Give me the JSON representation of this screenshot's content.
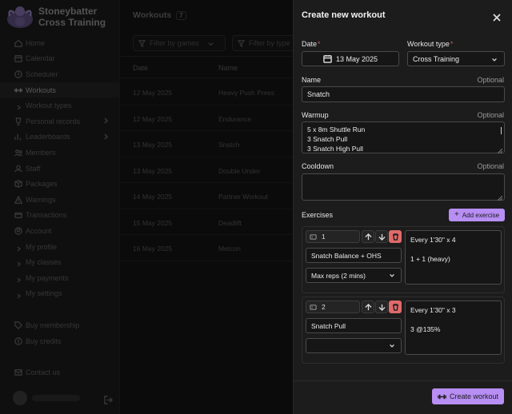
{
  "brand": {
    "line1": "Stoneybatter",
    "line2": "Cross Training"
  },
  "sidebar": {
    "items": [
      {
        "label": "Home",
        "icon": "home-icon"
      },
      {
        "label": "Calendar",
        "icon": "calendar-icon"
      },
      {
        "label": "Scheduler",
        "icon": "clock-icon"
      },
      {
        "label": "Workouts",
        "icon": "dumbbell-icon",
        "active": true
      },
      {
        "label": "Workout types",
        "sub": true
      },
      {
        "label": "Personal records",
        "icon": "trophy-icon",
        "chevron": true
      },
      {
        "label": "Leaderboards",
        "icon": "chart-icon",
        "chevron": true
      },
      {
        "label": "Members",
        "icon": "users-icon"
      },
      {
        "label": "Staff",
        "icon": "user-icon"
      },
      {
        "label": "Packages",
        "icon": "box-icon"
      },
      {
        "label": "Warnings",
        "icon": "warning-icon"
      },
      {
        "label": "Transactions",
        "icon": "card-icon"
      },
      {
        "label": "Account",
        "icon": "account-icon"
      },
      {
        "label": "My profile",
        "sub": true
      },
      {
        "label": "My classes",
        "sub": true
      },
      {
        "label": "My payments",
        "sub": true
      },
      {
        "label": "My settings",
        "sub": true
      },
      {
        "label": "Buy membership",
        "icon": "tag-icon",
        "gap": true
      },
      {
        "label": "Buy credits",
        "icon": "coin-icon"
      },
      {
        "label": "Contact us",
        "icon": "mail-icon",
        "gap": true
      }
    ]
  },
  "main": {
    "title": "Workouts",
    "count": "7",
    "filter_games": "Filter by games",
    "filter_type": "Filter by type",
    "columns": {
      "date": "Date",
      "name": "Name"
    },
    "rows": [
      {
        "date": "12 May 2025",
        "name": "Heavy Push Press"
      },
      {
        "date": "12 May 2025",
        "name": "Endurance"
      },
      {
        "date": "13 May 2025",
        "name": "Snatch"
      },
      {
        "date": "13 May 2025",
        "name": "Double Under"
      },
      {
        "date": "14 May 2025",
        "name": "Partner Workout"
      },
      {
        "date": "15 May 2025",
        "name": "Deadlift"
      },
      {
        "date": "16 May 2025",
        "name": "Metcon"
      }
    ]
  },
  "panel": {
    "title": "Create new workout",
    "date_label": "Date",
    "date_value": "13 May 2025",
    "type_label": "Workout type",
    "type_value": "Cross Training",
    "required_mark": "*",
    "name_label": "Name",
    "name_value": "Snatch",
    "optional": "Optional",
    "warmup_label": "Warmup",
    "warmup_lines": [
      "5 x 8m Shuttle Run",
      "3 Snatch Pull",
      "3 Snatch High Pull"
    ],
    "cooldown_label": "Cooldown",
    "exercises_label": "Exercises",
    "add_exercise": "Add exercise",
    "exercises": [
      {
        "num": "1",
        "name": "Snatch Balance + OHS",
        "reps": "Max reps (2 mins)",
        "note1": "Every 1'30\" x 4",
        "note2": "1 + 1  (heavy)"
      },
      {
        "num": "2",
        "name": "Snatch Pull",
        "reps": "",
        "note1": "Every 1'30\" x 3",
        "note2": "3 @135%"
      }
    ],
    "create_button": "Create workout"
  },
  "colors": {
    "accent": "#b78ef3",
    "danger": "#e06a6a",
    "panel_bg": "#1c1c1c"
  }
}
